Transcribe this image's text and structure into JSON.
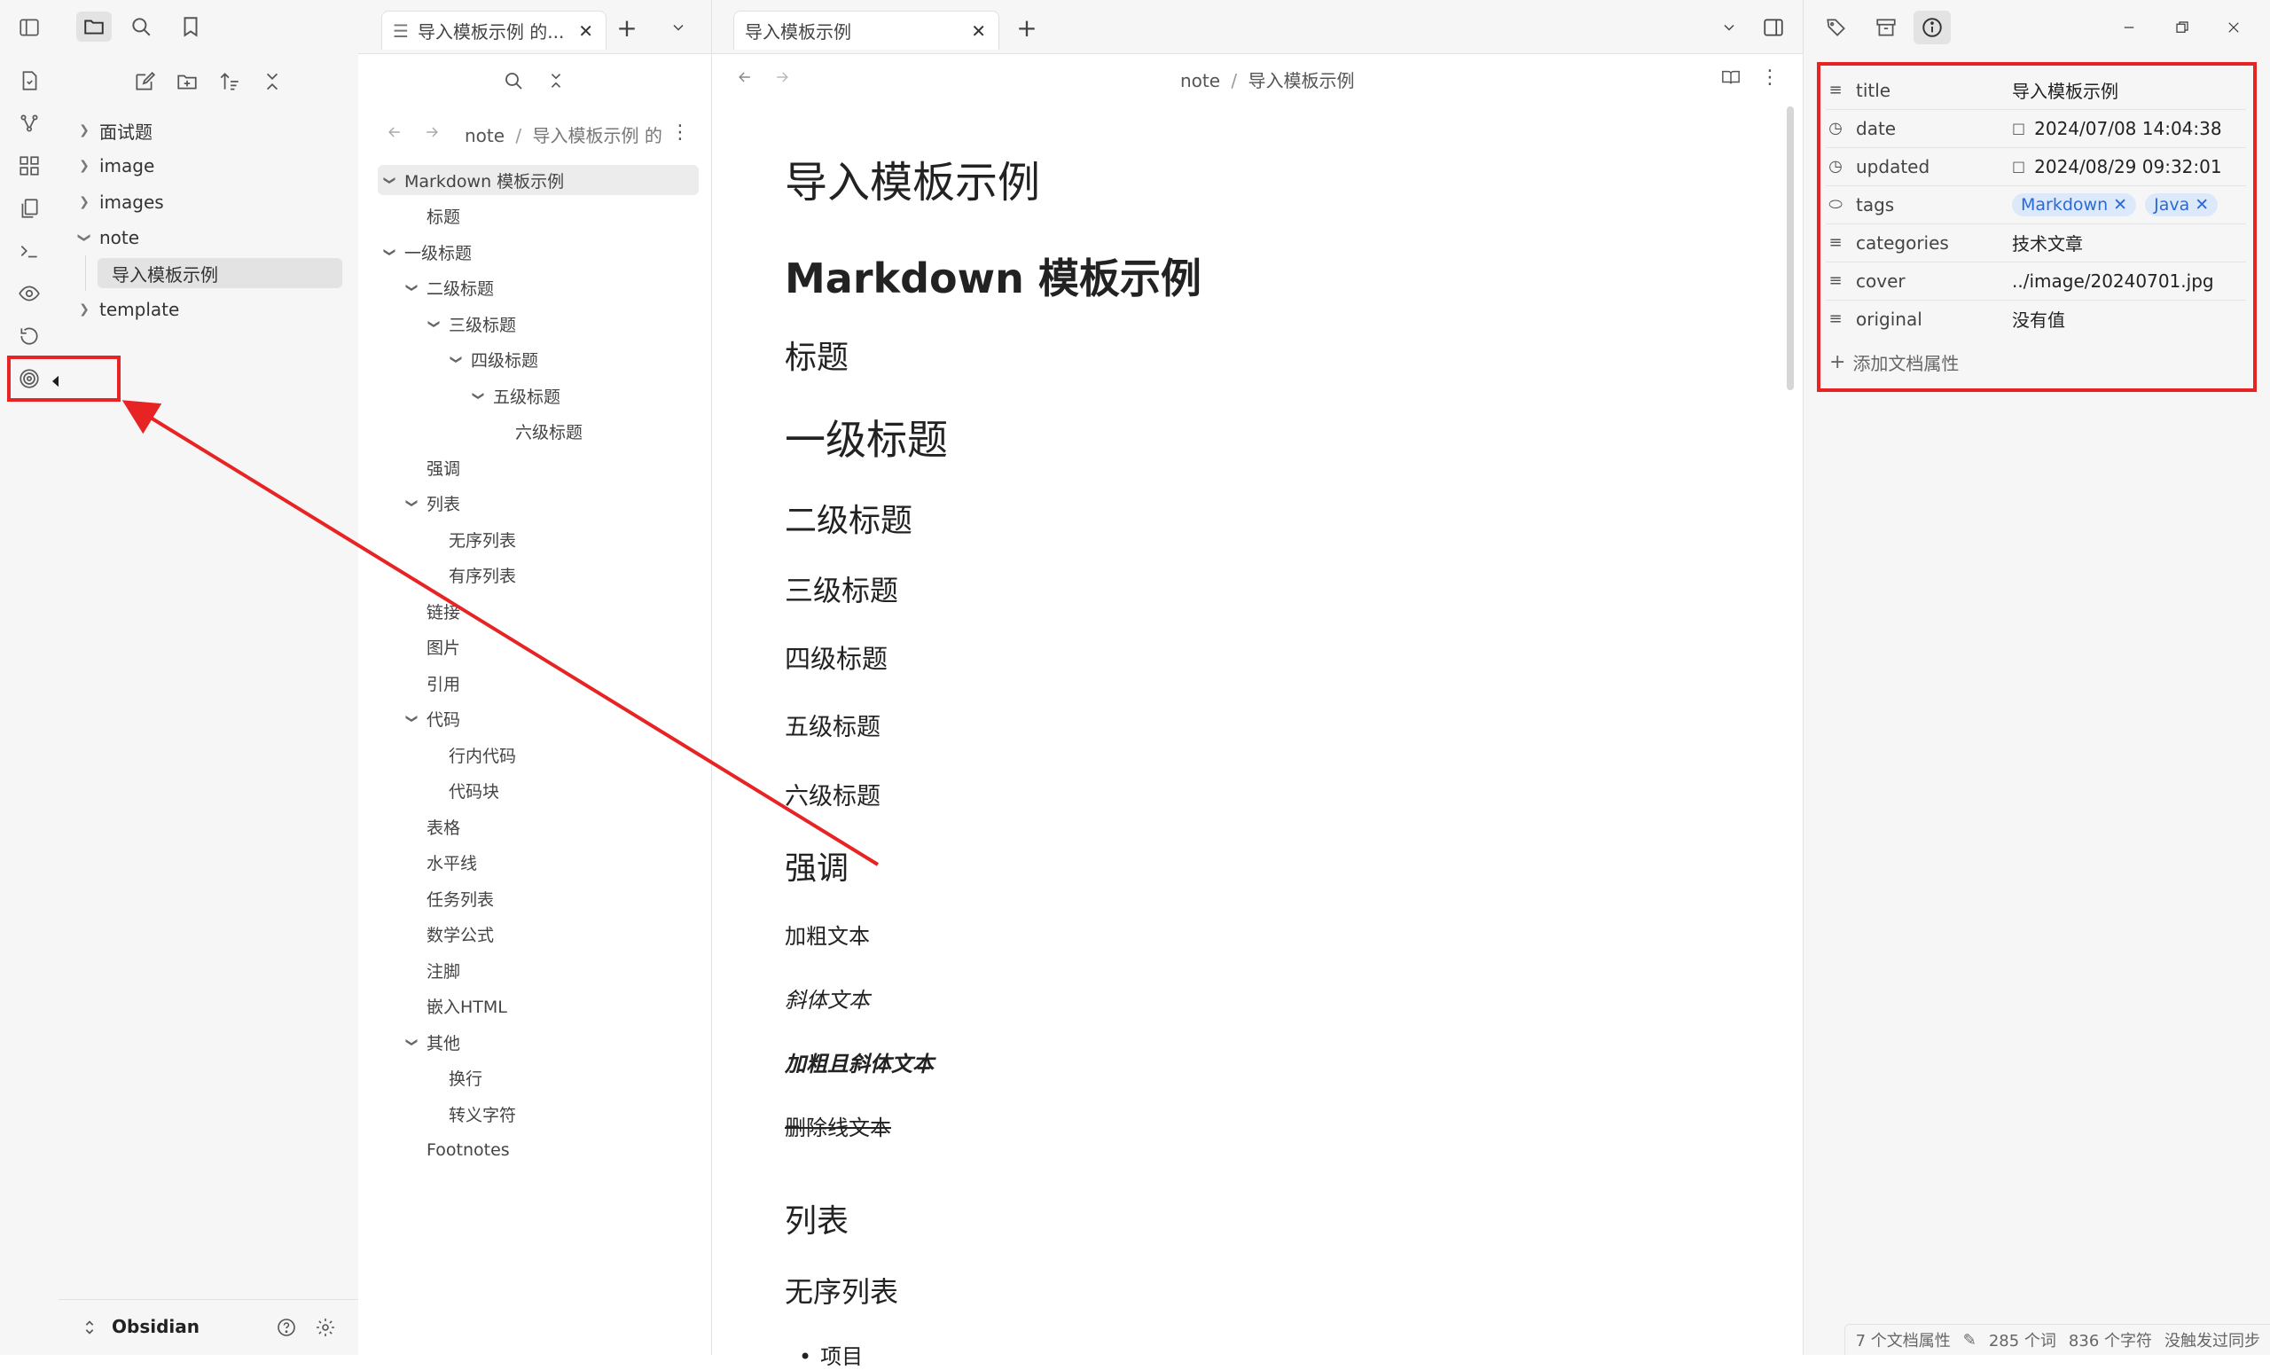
{
  "ribbon": {
    "tooltip": "发布",
    "icons": [
      "open-file-icon",
      "graph-icon",
      "canvas-icon",
      "templates-icon",
      "terminal-icon",
      "preview-icon",
      "sync-history-icon",
      "publish-icon"
    ]
  },
  "file_explorer": {
    "tree": [
      {
        "label": "面试题",
        "expanded": false
      },
      {
        "label": "image",
        "expanded": false
      },
      {
        "label": "images",
        "expanded": false
      },
      {
        "label": "note",
        "expanded": true
      },
      {
        "label": "导入模板示例",
        "active": true
      },
      {
        "label": "template",
        "expanded": false
      }
    ],
    "vault_name": "Obsidian"
  },
  "outline": {
    "tab_label": "导入模板示例 的...",
    "breadcrumb": [
      "note",
      "导入模板示例 的"
    ],
    "items": [
      {
        "label": "Markdown 模板示例",
        "level": 0,
        "chev": true
      },
      {
        "label": "标题",
        "level": 1
      },
      {
        "label": "一级标题",
        "level": 0,
        "chev": true
      },
      {
        "label": "二级标题",
        "level": 1,
        "chev": true
      },
      {
        "label": "三级标题",
        "level": 2,
        "chev": true
      },
      {
        "label": "四级标题",
        "level": 3,
        "chev": true
      },
      {
        "label": "五级标题",
        "level": 4,
        "chev": true
      },
      {
        "label": "六级标题",
        "level": 5
      },
      {
        "label": "强调",
        "level": 1
      },
      {
        "label": "列表",
        "level": 1,
        "chev": true
      },
      {
        "label": "无序列表",
        "level": 2
      },
      {
        "label": "有序列表",
        "level": 2
      },
      {
        "label": "链接",
        "level": 1
      },
      {
        "label": "图片",
        "level": 1
      },
      {
        "label": "引用",
        "level": 1
      },
      {
        "label": "代码",
        "level": 1,
        "chev": true
      },
      {
        "label": "行内代码",
        "level": 2
      },
      {
        "label": "代码块",
        "level": 2
      },
      {
        "label": "表格",
        "level": 1
      },
      {
        "label": "水平线",
        "level": 1
      },
      {
        "label": "任务列表",
        "level": 1
      },
      {
        "label": "数学公式",
        "level": 1
      },
      {
        "label": "注脚",
        "level": 1
      },
      {
        "label": "嵌入HTML",
        "level": 1
      },
      {
        "label": "其他",
        "level": 1,
        "chev": true
      },
      {
        "label": "换行",
        "level": 2
      },
      {
        "label": "转义字符",
        "level": 2
      },
      {
        "label": "Footnotes",
        "level": 1
      }
    ]
  },
  "editor": {
    "tab_label": "导入模板示例",
    "breadcrumb": [
      "note",
      "导入模板示例"
    ],
    "content": {
      "title": "导入模板示例",
      "h1": "Markdown 模板示例",
      "heading": "标题",
      "level1": "一级标题",
      "level2": "二级标题",
      "level3": "三级标题",
      "level4": "四级标题",
      "level5": "五级标题",
      "level6": "六级标题",
      "emphasis": "强调",
      "bold": "加粗文本",
      "italic": "斜体文本",
      "bold_italic": "加粗且斜体文本",
      "strike": "删除线文本",
      "list": "列表",
      "unordered": "无序列表",
      "bullet": "项目"
    }
  },
  "properties": {
    "rows": [
      {
        "icon": "text-icon",
        "key": "title",
        "value": "导入模板示例"
      },
      {
        "icon": "clock-icon",
        "key": "date",
        "value": "2024/07/08  14:04:38",
        "cal": true
      },
      {
        "icon": "clock-icon",
        "key": "updated",
        "value": "2024/08/29  09:32:01",
        "cal": true
      },
      {
        "icon": "tags-icon",
        "key": "tags",
        "tags": [
          "Markdown",
          "Java"
        ]
      },
      {
        "icon": "text-icon",
        "key": "categories",
        "value": "技术文章"
      },
      {
        "icon": "text-icon",
        "key": "cover",
        "value": "../image/20240701.jpg"
      },
      {
        "icon": "text-icon",
        "key": "original",
        "value": "没有值",
        "empty": true
      }
    ],
    "add_label": "添加文档属性"
  },
  "status_bar": {
    "props": "7 个文档属性",
    "words": "285 个词",
    "chars": "836 个字符",
    "sync": "没触发过同步"
  },
  "colors": {
    "annotation": "#e82323",
    "tag_bg": "#dce9fb",
    "tag_text": "#2a6ad6"
  }
}
